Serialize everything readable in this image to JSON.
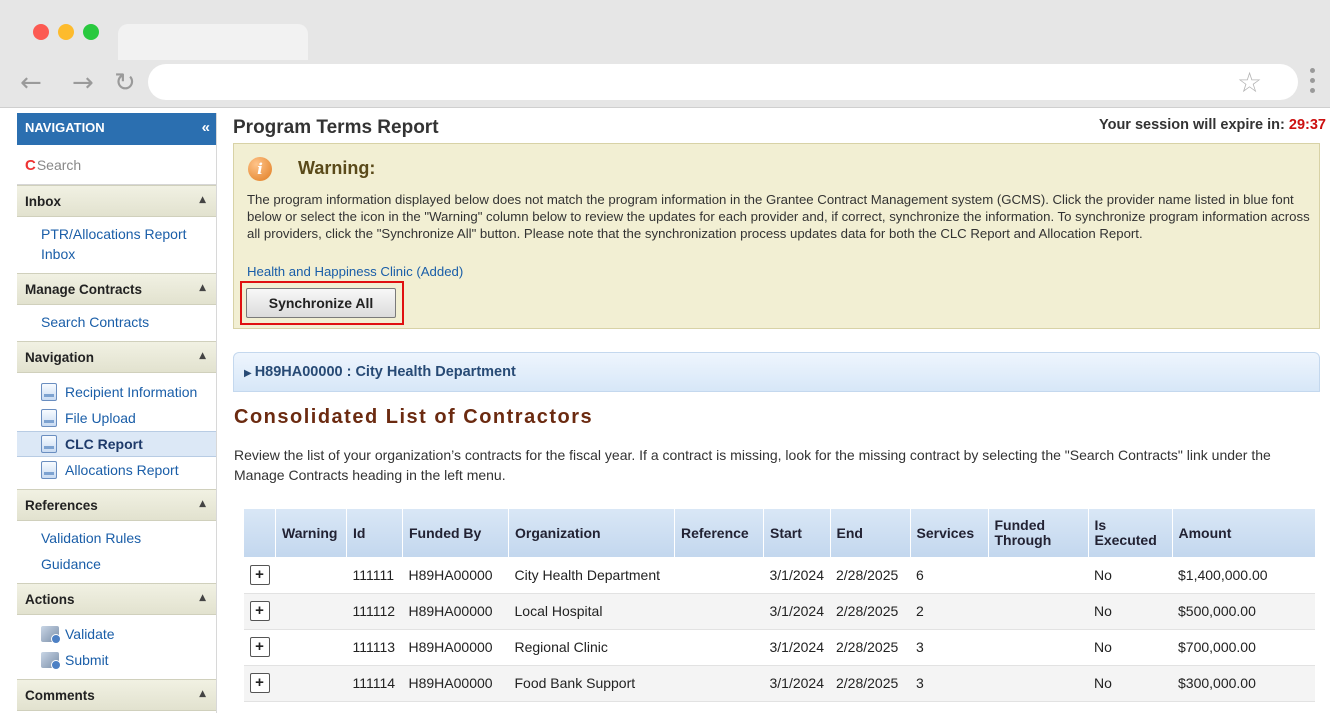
{
  "sidebar": {
    "title": "NAVIGATION",
    "collapse_glyph": "«",
    "search_mark": "C",
    "search_placeholder": "Search",
    "inbox": {
      "label": "Inbox",
      "items": [
        "PTR/Allocations Report Inbox"
      ]
    },
    "manage_contracts": {
      "label": "Manage Contracts",
      "items": [
        "Search Contracts"
      ]
    },
    "navigation": {
      "label": "Navigation",
      "items": [
        "Recipient Information",
        "File Upload",
        "CLC Report",
        "Allocations Report"
      ],
      "active": "CLC Report"
    },
    "references": {
      "label": "References",
      "items": [
        "Validation Rules",
        "Guidance"
      ]
    },
    "actions": {
      "label": "Actions",
      "items": [
        "Validate",
        "Submit"
      ]
    },
    "comments": {
      "label": "Comments"
    }
  },
  "header": {
    "page_title": "Program Terms Report",
    "session_label": "Your session will expire in:",
    "session_timer": "29:37"
  },
  "warning": {
    "icon": "info-icon",
    "title": "Warning:",
    "message": "The program information displayed below does not match the program information in the Grantee Contract Management system (GCMS). Click the provider name listed in blue font below or select the icon in the \"Warning\" column below to review the updates for each provider and, if correct, synchronize the information. To synchronize program information across all providers, click the \"Synchronize All\" button. Please note that the synchronization process updates data for both the CLC Report and Allocation Report.",
    "provider_link": "Health and Happiness Clinic (Added)",
    "sync_button": "Synchronize All"
  },
  "org_bar": {
    "label": "H89HA00000 : City Health Department"
  },
  "clc": {
    "title": "Consolidated List of Contractors",
    "description": "Review the list of your organization’s contracts for the fiscal year. If a contract is missing, look for the missing contract by selecting the \"Search Contracts\" link under the Manage Contracts heading in the left menu."
  },
  "table": {
    "columns": [
      "Warning",
      "Id",
      "Funded By",
      "Organization",
      "Reference",
      "Start",
      "End",
      "Services",
      "Funded Through",
      "Is Executed",
      "Amount"
    ],
    "rows": [
      {
        "id": "111111",
        "funded_by": "H89HA00000",
        "organization": "City Health Department",
        "reference": "",
        "start": "3/1/2024",
        "end": "2/28/2025",
        "services": "6",
        "funded_through": "",
        "is_executed": "No",
        "amount": "$1,400,000.00"
      },
      {
        "id": "111112",
        "funded_by": "H89HA00000",
        "organization": "Local Hospital",
        "reference": "",
        "start": "3/1/2024",
        "end": "2/28/2025",
        "services": "2",
        "funded_through": "",
        "is_executed": "No",
        "amount": "$500,000.00"
      },
      {
        "id": "111113",
        "funded_by": "H89HA00000",
        "organization": "Regional Clinic",
        "reference": "",
        "start": "3/1/2024",
        "end": "2/28/2025",
        "services": "3",
        "funded_through": "",
        "is_executed": "No",
        "amount": "$700,000.00"
      },
      {
        "id": "111114",
        "funded_by": "H89HA00000",
        "organization": "Food Bank Support",
        "reference": "",
        "start": "3/1/2024",
        "end": "2/28/2025",
        "services": "3",
        "funded_through": "",
        "is_executed": "No",
        "amount": "$300,000.00"
      }
    ]
  },
  "colors": {
    "nav_header": "#2b6fb0",
    "link": "#1a5ea8",
    "timer": "#cc1010",
    "highlight_outline": "#e01010",
    "clc_title": "#6b2a10"
  }
}
